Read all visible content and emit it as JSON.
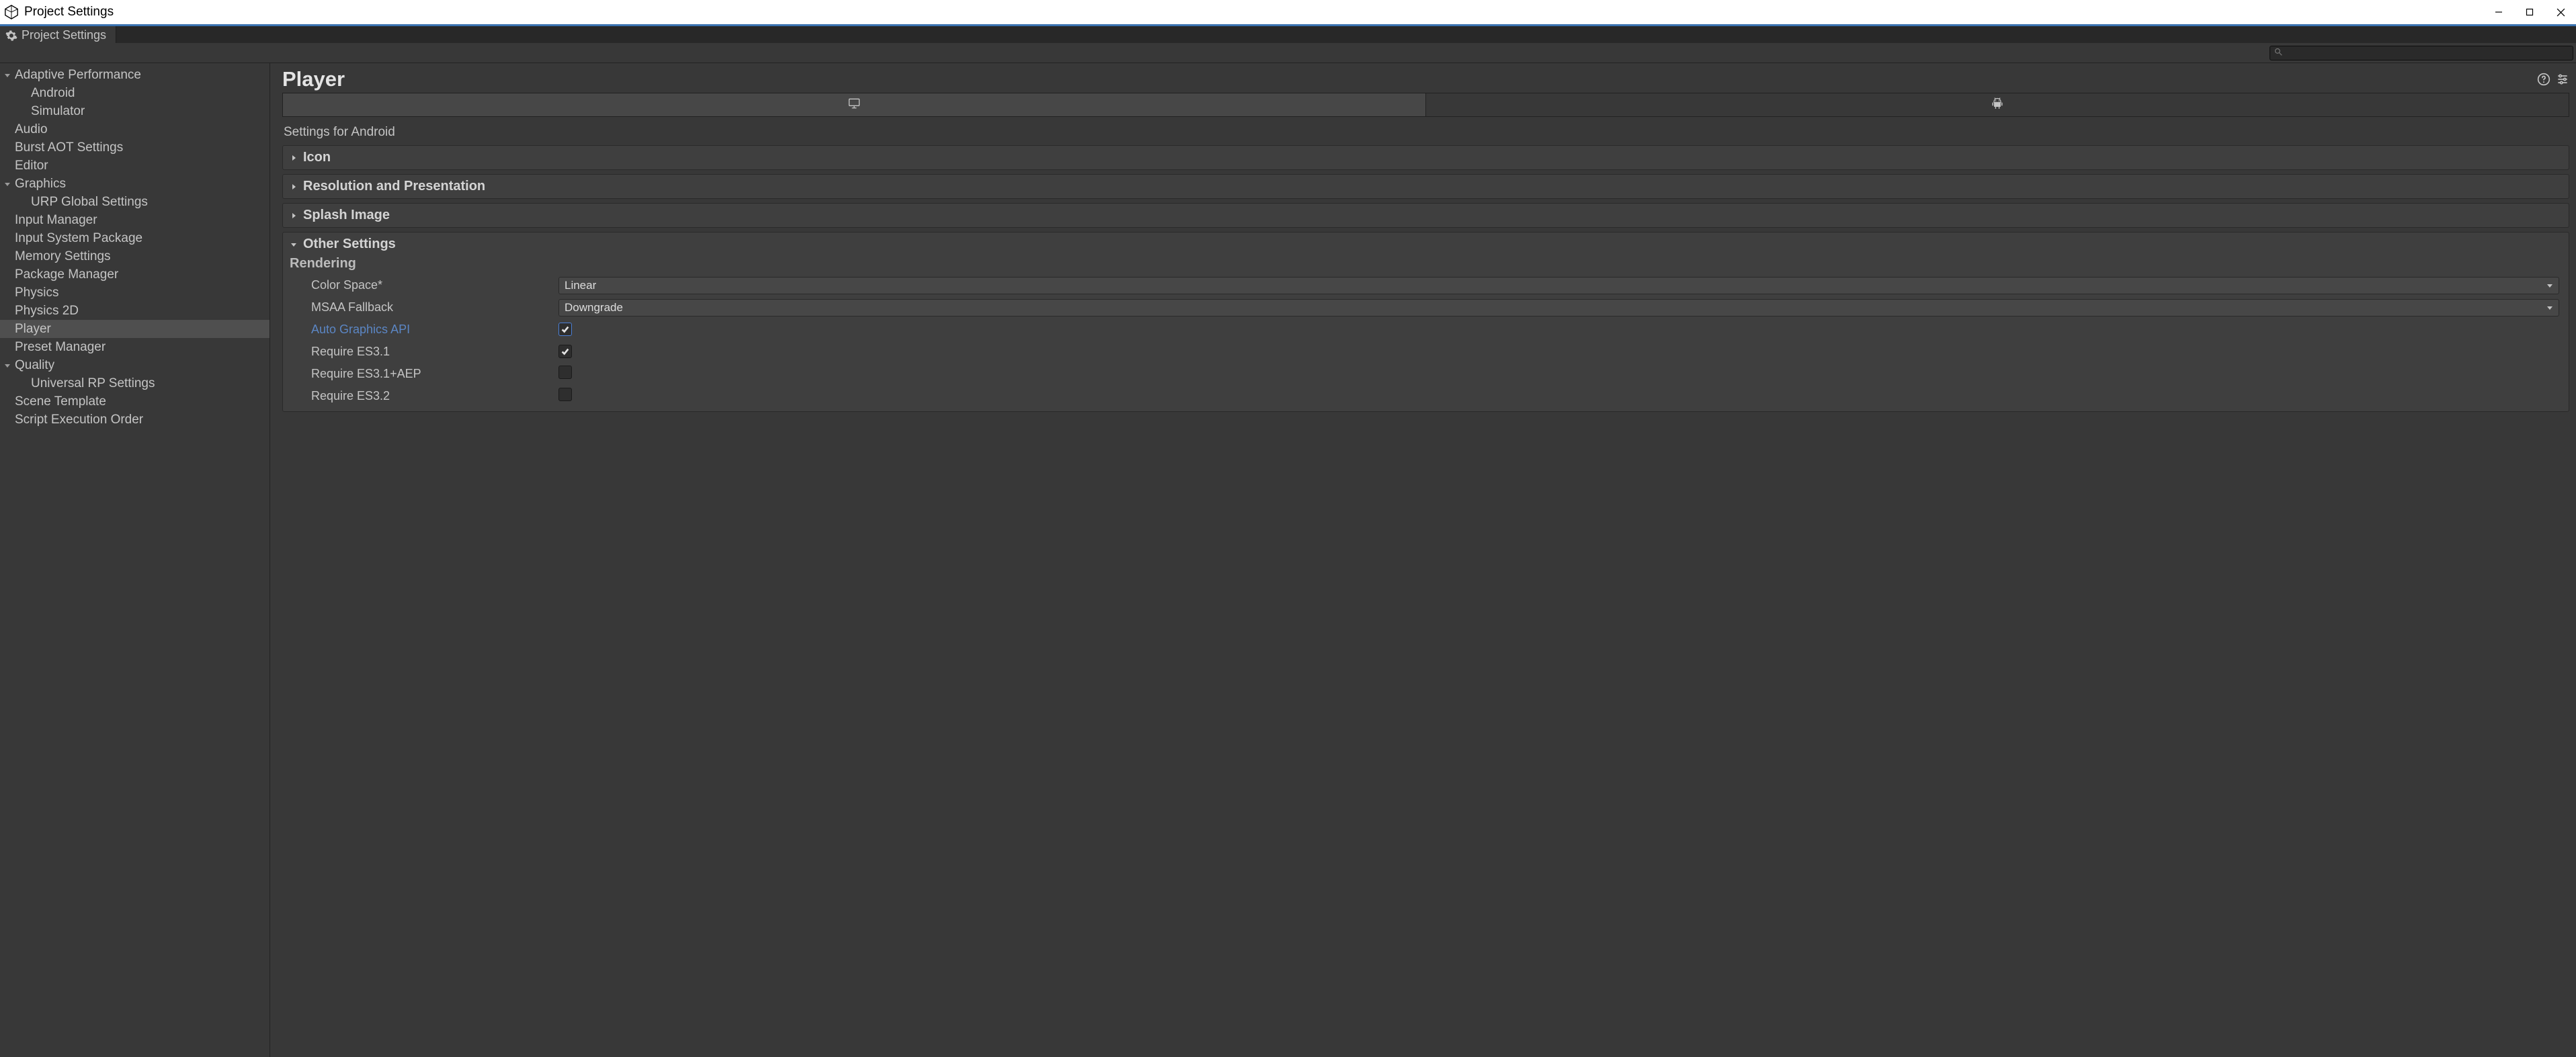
{
  "window": {
    "title": "Project Settings",
    "tab_title": "Project Settings"
  },
  "search": {
    "placeholder": ""
  },
  "sidebar": [
    {
      "label": "Adaptive Performance",
      "depth": 0,
      "expandable": true,
      "expanded": true
    },
    {
      "label": "Android",
      "depth": 1,
      "expandable": false
    },
    {
      "label": "Simulator",
      "depth": 1,
      "expandable": false
    },
    {
      "label": "Audio",
      "depth": 0,
      "expandable": false
    },
    {
      "label": "Burst AOT Settings",
      "depth": 0,
      "expandable": false
    },
    {
      "label": "Editor",
      "depth": 0,
      "expandable": false
    },
    {
      "label": "Graphics",
      "depth": 0,
      "expandable": true,
      "expanded": true
    },
    {
      "label": "URP Global Settings",
      "depth": 1,
      "expandable": false
    },
    {
      "label": "Input Manager",
      "depth": 0,
      "expandable": false
    },
    {
      "label": "Input System Package",
      "depth": 0,
      "expandable": false
    },
    {
      "label": "Memory Settings",
      "depth": 0,
      "expandable": false
    },
    {
      "label": "Package Manager",
      "depth": 0,
      "expandable": false
    },
    {
      "label": "Physics",
      "depth": 0,
      "expandable": false
    },
    {
      "label": "Physics 2D",
      "depth": 0,
      "expandable": false
    },
    {
      "label": "Player",
      "depth": 0,
      "expandable": false,
      "selected": true
    },
    {
      "label": "Preset Manager",
      "depth": 0,
      "expandable": false
    },
    {
      "label": "Quality",
      "depth": 0,
      "expandable": true,
      "expanded": true
    },
    {
      "label": "Universal RP Settings",
      "depth": 1,
      "expandable": false
    },
    {
      "label": "Scene Template",
      "depth": 0,
      "expandable": false
    },
    {
      "label": "Script Execution Order",
      "depth": 0,
      "expandable": false
    }
  ],
  "main": {
    "title": "Player",
    "platform_tabs": [
      {
        "icon": "desktop",
        "active": true
      },
      {
        "icon": "android",
        "active": false
      }
    ],
    "settings_for": "Settings for Android",
    "foldouts": [
      {
        "title": "Icon",
        "expanded": false
      },
      {
        "title": "Resolution and Presentation",
        "expanded": false
      },
      {
        "title": "Splash Image",
        "expanded": false
      }
    ],
    "other_settings": {
      "title": "Other Settings",
      "rendering_label": "Rendering",
      "rows": [
        {
          "label": "Color Space*",
          "type": "dropdown",
          "value": "Linear"
        },
        {
          "label": "MSAA Fallback",
          "type": "dropdown",
          "value": "Downgrade"
        },
        {
          "label": "Auto Graphics API",
          "type": "checkbox",
          "checked": true,
          "highlight": true,
          "link": true
        },
        {
          "label": "Require ES3.1",
          "type": "checkbox",
          "checked": true
        },
        {
          "label": "Require ES3.1+AEP",
          "type": "checkbox",
          "checked": false
        },
        {
          "label": "Require ES3.2",
          "type": "checkbox",
          "checked": false
        }
      ]
    }
  }
}
